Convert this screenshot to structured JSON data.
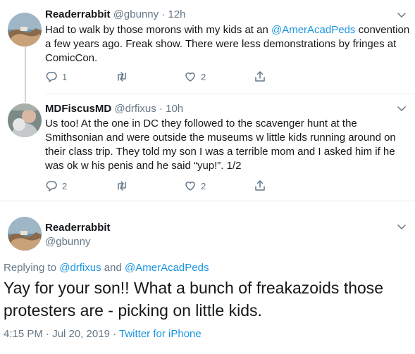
{
  "tweets": [
    {
      "name": "Readerrabbit",
      "handle": "@gbunny",
      "sep": "·",
      "time": "12h",
      "text_before": "Had to walk by those morons with my kids at an ",
      "mention": "@AmerAcadPeds",
      "text_after": " convention a few years ago. Freak show. There were less demonstrations by fringes at ComicCon.",
      "reply_count": "1",
      "retweet_count": "",
      "like_count": "2"
    },
    {
      "name": "MDFiscusMD",
      "handle": "@drfixus",
      "sep": "·",
      "time": "10h",
      "text": "Us too! At the one in DC they followed to the scavenger hunt at the Smithsonian and were outside the museums w little kids running around on their class trip. They told my son I was a terrible mom and I asked him if he was ok w his penis and he said “yup!”. 1/2",
      "reply_count": "2",
      "retweet_count": "",
      "like_count": "2"
    }
  ],
  "focused": {
    "name": "Readerrabbit",
    "handle": "@gbunny",
    "replying_prefix": "Replying to ",
    "replying_user1": "@drfixus",
    "replying_and": " and ",
    "replying_user2": "@AmerAcadPeds",
    "text": "Yay for your son!! What a bunch of freakazoids those protesters are - picking on little kids.",
    "timestamp": "4:15 PM · Jul 20, 2019",
    "meta_sep": " · ",
    "source": "Twitter for iPhone"
  },
  "icons": {
    "reply": "reply-icon",
    "retweet": "retweet-icon",
    "like": "heart-icon",
    "share": "share-icon",
    "more": "chevron-down-icon"
  },
  "colors": {
    "link": "#1b95e0",
    "secondary": "#657786",
    "thread_line": "#ccd6dd"
  }
}
